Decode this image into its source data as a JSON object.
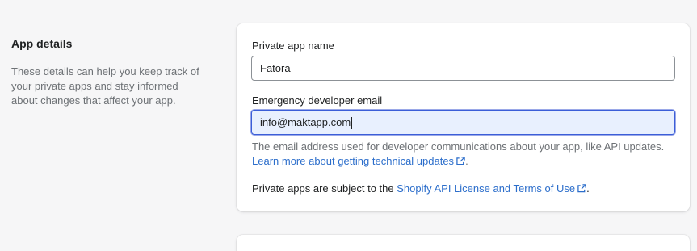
{
  "section": {
    "title": "App details",
    "description": "These details can help you keep track of your private apps and stay informed about changes that affect your app."
  },
  "form": {
    "app_name_label": "Private app name",
    "app_name_value": "Fatora",
    "email_label": "Emergency developer email",
    "email_value": "info@maktapp.com",
    "help_text": "The email address used for developer communications about your app, like API updates.",
    "help_link": "Learn more about getting technical updates",
    "help_end": ".",
    "notice_text": "Private apps are subject to the",
    "notice_link": "Shopify API License and Terms of Use",
    "notice_end": "."
  },
  "colors": {
    "link": "#2c6ecb",
    "focus_border": "#3b5ed8",
    "focus_background": "#e8f0fe"
  },
  "icons": [
    "external-link-icon"
  ]
}
